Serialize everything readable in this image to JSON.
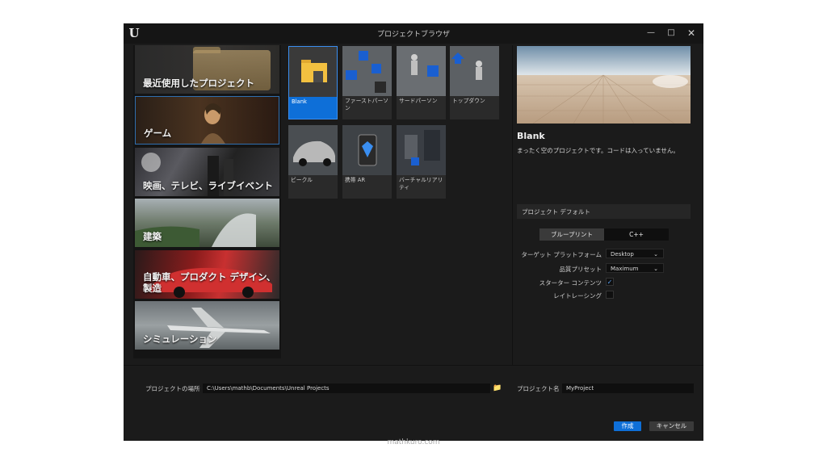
{
  "window": {
    "title": "プロジェクトブラウザ",
    "logo": "U"
  },
  "window_controls": {
    "minimize": "—",
    "maximize": "□",
    "close": "✕"
  },
  "categories": [
    {
      "label": "最近使用したプロジェクト",
      "selected": false
    },
    {
      "label": "ゲーム",
      "selected": true
    },
    {
      "label": "映画、テレビ、ライブイベント",
      "selected": false
    },
    {
      "label": "建築",
      "selected": false
    },
    {
      "label": "自動車、プロダクト デザイン、製造",
      "selected": false
    },
    {
      "label": "シミュレーション",
      "selected": false
    }
  ],
  "templates": [
    {
      "label": "Blank",
      "selected": true
    },
    {
      "label": "ファーストパーソン",
      "selected": false
    },
    {
      "label": "サードパーソン",
      "selected": false
    },
    {
      "label": "トップダウン",
      "selected": false
    },
    {
      "label": "ビークル",
      "selected": false
    },
    {
      "label": "携帯 AR",
      "selected": false
    },
    {
      "label": "バーチャルリアリティ",
      "selected": false
    }
  ],
  "preview": {
    "title": "Blank",
    "description": "まったく空のプロジェクトです。コードは入っていません。"
  },
  "defaults": {
    "header": "プロジェクト デフォルト",
    "toggle": {
      "blueprint": "ブループリント",
      "cpp": "C++",
      "selected": "blueprint"
    },
    "target_platform": {
      "label": "ターゲット プラットフォーム",
      "value": "Desktop"
    },
    "quality_preset": {
      "label": "品質プリセット",
      "value": "Maximum"
    },
    "starter_content": {
      "label": "スターター コンテンツ",
      "checked": true
    },
    "ray_tracing": {
      "label": "レイトレーシング",
      "checked": false
    }
  },
  "project_location": {
    "label": "プロジェクトの場所",
    "value": "C:\\Users\\mathb\\Documents\\Unreal Projects"
  },
  "project_name": {
    "label": "プロジェクト名",
    "value": "MyProject"
  },
  "buttons": {
    "create": "作成",
    "cancel": "キャンセル"
  },
  "watermark": "mathkuro.com",
  "colors": {
    "accent": "#0e6fd8",
    "window_bg": "#1b1b1b",
    "titlebar_bg": "#151515"
  }
}
